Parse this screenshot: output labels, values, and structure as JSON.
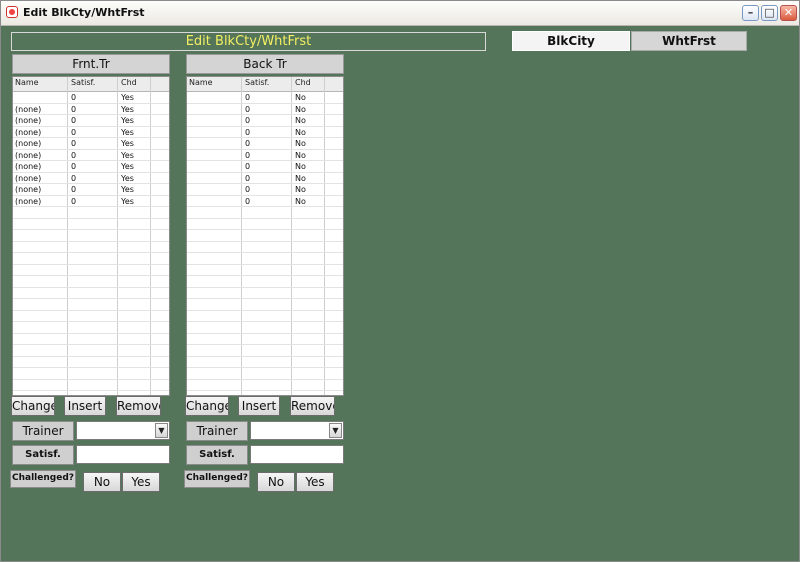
{
  "window": {
    "title": "Edit BlkCty/WhtFrst"
  },
  "header": {
    "title": "Edit BlkCty/WhtFrst"
  },
  "tabs": [
    {
      "label": "BlkCity",
      "active": true
    },
    {
      "label": "WhtFrst",
      "active": false
    }
  ],
  "panels": [
    {
      "title": "Frnt.Tr",
      "columns": [
        "Name",
        "Satisf.",
        "Chd"
      ],
      "rows": [
        [
          "",
          "0",
          "Yes"
        ],
        [
          "(none)",
          "0",
          "Yes"
        ],
        [
          "(none)",
          "0",
          "Yes"
        ],
        [
          "(none)",
          "0",
          "Yes"
        ],
        [
          "(none)",
          "0",
          "Yes"
        ],
        [
          "(none)",
          "0",
          "Yes"
        ],
        [
          "(none)",
          "0",
          "Yes"
        ],
        [
          "(none)",
          "0",
          "Yes"
        ],
        [
          "(none)",
          "0",
          "Yes"
        ],
        [
          "(none)",
          "0",
          "Yes"
        ]
      ],
      "buttons": {
        "change": "Change",
        "insert": "Insert",
        "remove": "Remove"
      },
      "trainer_label": "Trainer",
      "trainer_value": "",
      "satisf_label": "Satisf.",
      "satisf_value": "",
      "challenged_label": "Challenged?",
      "no": "No",
      "yes": "Yes"
    },
    {
      "title": "Back Tr",
      "columns": [
        "Name",
        "Satisf.",
        "Chd"
      ],
      "rows": [
        [
          "",
          "0",
          "No"
        ],
        [
          "",
          "0",
          "No"
        ],
        [
          "",
          "0",
          "No"
        ],
        [
          "",
          "0",
          "No"
        ],
        [
          "",
          "0",
          "No"
        ],
        [
          "",
          "0",
          "No"
        ],
        [
          "",
          "0",
          "No"
        ],
        [
          "",
          "0",
          "No"
        ],
        [
          "",
          "0",
          "No"
        ],
        [
          "",
          "0",
          "No"
        ]
      ],
      "buttons": {
        "change": "Change",
        "insert": "Insert",
        "remove": "Remove"
      },
      "trainer_label": "Trainer",
      "trainer_value": "",
      "satisf_label": "Satisf.",
      "satisf_value": "",
      "challenged_label": "Challenged?",
      "no": "No",
      "yes": "Yes"
    }
  ],
  "colors": {
    "background": "#54755a",
    "header_text": "#f3ef63"
  },
  "icons": {
    "app": "app-icon",
    "minimize": "minimize-icon",
    "maximize": "maximize-icon",
    "close": "close-icon",
    "dropdown": "chevron-down-icon"
  }
}
